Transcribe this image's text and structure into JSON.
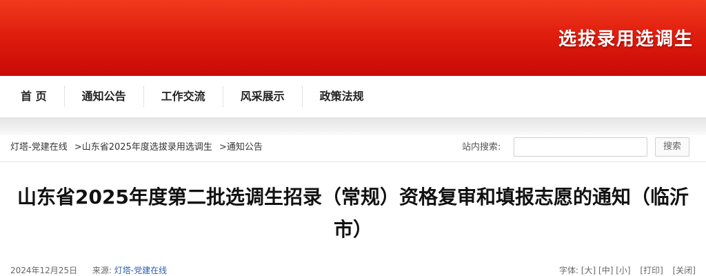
{
  "banner": {
    "title": "选拔录用选调生"
  },
  "nav": {
    "items": [
      {
        "label": "首 页"
      },
      {
        "label": "通知公告"
      },
      {
        "label": "工作交流"
      },
      {
        "label": "风采展示"
      },
      {
        "label": "政策法规"
      }
    ]
  },
  "breadcrumb": {
    "items": [
      "灯塔-党建在线",
      "山东省2025年度选拔录用选调生",
      "通知公告"
    ],
    "separator": ">"
  },
  "search": {
    "label": "站内搜索:",
    "value": "",
    "button_label": "搜索"
  },
  "article": {
    "title": "山东省2025年度第二批选调生招录（常规）资格复审和填报志愿的通知（临沂市）",
    "date": "2024年12月25日",
    "source_label": "来源:",
    "source": "灯塔-党建在线"
  },
  "tools": {
    "font_label": "字体:",
    "size_large": "[大]",
    "size_medium": "[中]",
    "size_small": "[小]",
    "print": "[打印]",
    "close": "[关闭]"
  },
  "colors": {
    "banner_red": "#e01e0e",
    "link_blue": "#2a5db0"
  }
}
